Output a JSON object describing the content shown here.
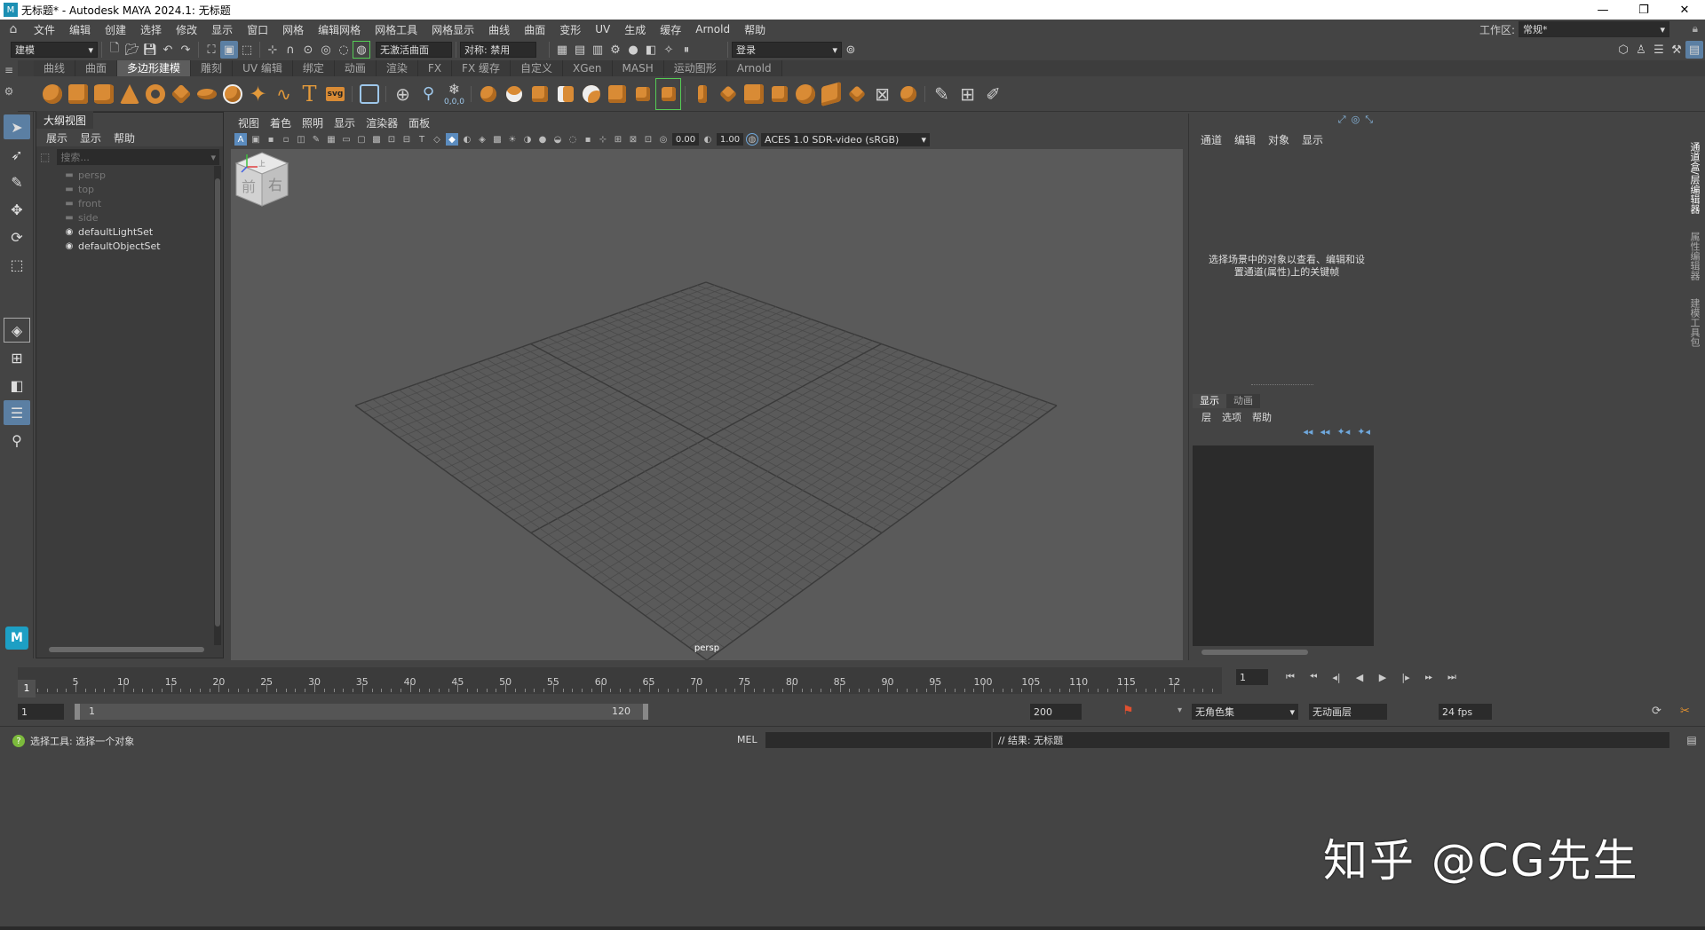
{
  "window": {
    "title": "无标题* - Autodesk MAYA 2024.1: 无标题",
    "controls": [
      "—",
      "❐",
      "✕"
    ]
  },
  "menubar": {
    "items": [
      "文件",
      "编辑",
      "创建",
      "选择",
      "修改",
      "显示",
      "窗口",
      "网格",
      "编辑网格",
      "网格工具",
      "网格显示",
      "曲线",
      "曲面",
      "变形",
      "UV",
      "生成",
      "缓存",
      "Arnold",
      "帮助"
    ],
    "workspace_label": "工作区:",
    "workspace_value": "常规*"
  },
  "statusline": {
    "menuset": "建模",
    "live_surface": "无激活曲面",
    "symmetry": "对称: 禁用",
    "login": "登录"
  },
  "shelf": {
    "tabs": [
      "曲线",
      "曲面",
      "多边形建模",
      "雕刻",
      "UV 编辑",
      "绑定",
      "动画",
      "渲染",
      "FX",
      "FX 缓存",
      "自定义",
      "XGen",
      "MASH",
      "运动图形",
      "Arnold"
    ],
    "active_tab": "多边形建模",
    "svg_label": "svg",
    "zero_label": "0,0,0"
  },
  "outliner": {
    "title": "大纲视图",
    "menu": [
      "展示",
      "显示",
      "帮助"
    ],
    "search_placeholder": "搜索...",
    "items": [
      {
        "label": "persp",
        "kind": "camera"
      },
      {
        "label": "top",
        "kind": "camera"
      },
      {
        "label": "front",
        "kind": "camera"
      },
      {
        "label": "side",
        "kind": "camera"
      },
      {
        "label": "defaultLightSet",
        "kind": "set"
      },
      {
        "label": "defaultObjectSet",
        "kind": "set"
      }
    ]
  },
  "viewport": {
    "menu": [
      "视图",
      "着色",
      "照明",
      "显示",
      "渲染器",
      "面板"
    ],
    "exposure": "0.00",
    "gamma": "1.00",
    "colorspace": "ACES 1.0 SDR-video (sRGB)",
    "camera_label": "persp",
    "viewcube": {
      "top": "上",
      "front": "前",
      "right": "右"
    }
  },
  "channelbox": {
    "menu": [
      "通道",
      "编辑",
      "对象",
      "显示"
    ],
    "hint": "选择场景中的对象以查看、编辑和设置通道(属性)上的关键帧"
  },
  "layers": {
    "tabs": [
      "显示",
      "动画"
    ],
    "active_tab": "显示",
    "menu": [
      "层",
      "选项",
      "帮助"
    ]
  },
  "vertical_tabs": [
    "通道盒/层编辑器",
    "属性编辑器",
    "建模工具包"
  ],
  "timeslider": {
    "current_frame": "1",
    "ticks": [
      "5",
      "10",
      "15",
      "20",
      "25",
      "30",
      "35",
      "40",
      "45",
      "50",
      "55",
      "60",
      "65",
      "70",
      "75",
      "80",
      "85",
      "90",
      "95",
      "100",
      "105",
      "110",
      "115",
      "12"
    ],
    "frame_field": "1"
  },
  "range": {
    "start": "1",
    "inner_start": "1",
    "inner_end": "120",
    "end": "200",
    "character_set": "无角色集",
    "anim_layer": "无动画层",
    "fps": "24 fps"
  },
  "commandline": {
    "help_text": "选择工具: 选择一个对象",
    "mel_label": "MEL",
    "result": "// 结果: 无标题"
  },
  "watermark": "知乎 @CG先生"
}
